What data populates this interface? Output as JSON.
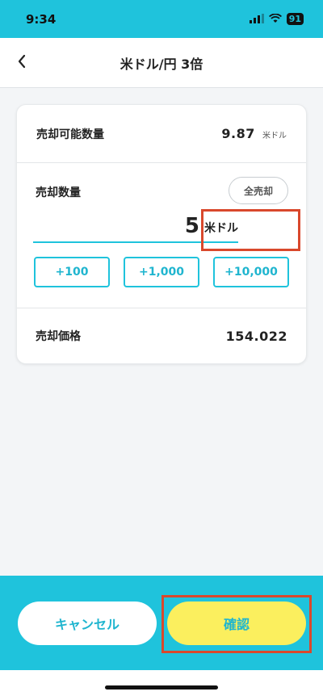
{
  "status": {
    "time": "9:34",
    "battery": "91"
  },
  "nav": {
    "title": "米ドル/円 3倍"
  },
  "available": {
    "label": "売却可能数量",
    "value": "9.87",
    "unit": "米ドル"
  },
  "quantity": {
    "label": "売却数量",
    "sell_all": "全売却",
    "amount": "5",
    "unit": "米ドル",
    "quick_buttons": [
      "+100",
      "+1,000",
      "+10,000"
    ]
  },
  "price": {
    "label": "売却価格",
    "value": "154.022"
  },
  "actions": {
    "cancel": "キャンセル",
    "confirm": "確認"
  },
  "colors": {
    "accent": "#1fc3dc",
    "confirm_bg": "#fbef5e",
    "highlight": "#d9482c"
  }
}
